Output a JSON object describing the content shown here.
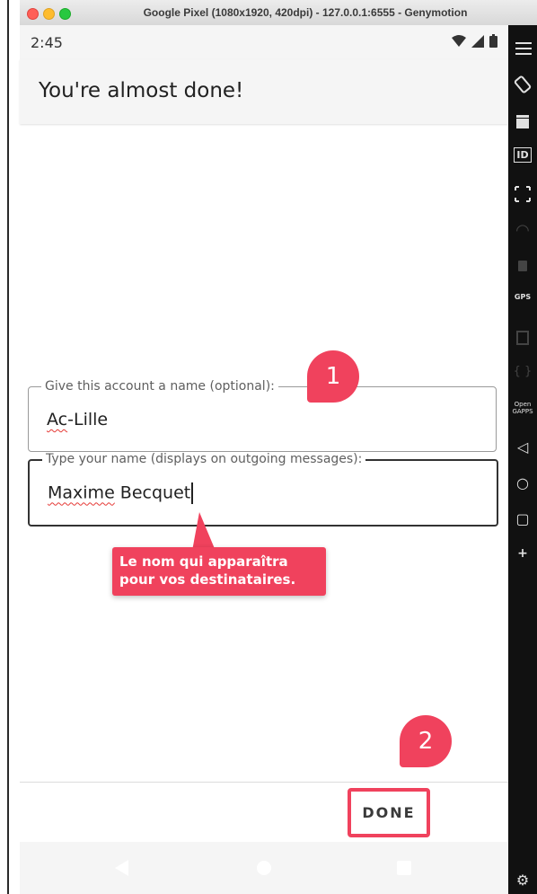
{
  "window": {
    "title": "Google Pixel (1080x1920, 420dpi) - 127.0.0.1:6555 - Genymotion"
  },
  "statusbar": {
    "time": "2:45"
  },
  "appbar": {
    "title": "You're almost done!"
  },
  "form": {
    "account_name": {
      "label": "Give this account a name (optional):",
      "value_part1": "Ac",
      "value_part2": "-Lille"
    },
    "your_name": {
      "label": "Type your name (displays on outgoing messages):",
      "value_part1": "Maxime",
      "value_part2": " Becquet"
    }
  },
  "annotations": {
    "badge1": "1",
    "badge2": "2",
    "callout_text": "Le nom qui apparaîtra pour vos destinataires."
  },
  "actions": {
    "done_label": "DONE"
  },
  "sidebar": {
    "id_label": "ID",
    "gps_label": "GPS",
    "open_label": "Open",
    "open_sub": "GAPPS",
    "plus": "+"
  },
  "colors": {
    "accent": "#f0425d"
  }
}
